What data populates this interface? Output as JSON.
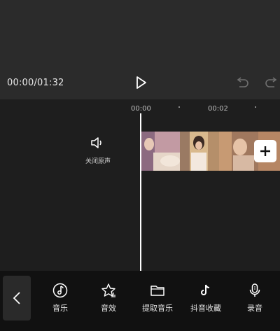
{
  "player": {
    "time_display": "00:00/01:32"
  },
  "timeline": {
    "ticks": [
      "00:00",
      "00:02"
    ],
    "mute_label": "关闭原声"
  },
  "toolbar": {
    "tools": [
      {
        "label": "音乐",
        "icon": "music-note-icon"
      },
      {
        "label": "音效",
        "icon": "star-sound-icon"
      },
      {
        "label": "提取音乐",
        "icon": "folder-icon"
      },
      {
        "label": "抖音收藏",
        "icon": "tiktok-icon"
      },
      {
        "label": "录音",
        "icon": "microphone-icon"
      }
    ]
  },
  "colors": {
    "preview_bg": "#2b2b2b",
    "timeline_bg": "#1e1e1e",
    "toolbar_bg": "#111111",
    "playhead": "#ffffff"
  }
}
